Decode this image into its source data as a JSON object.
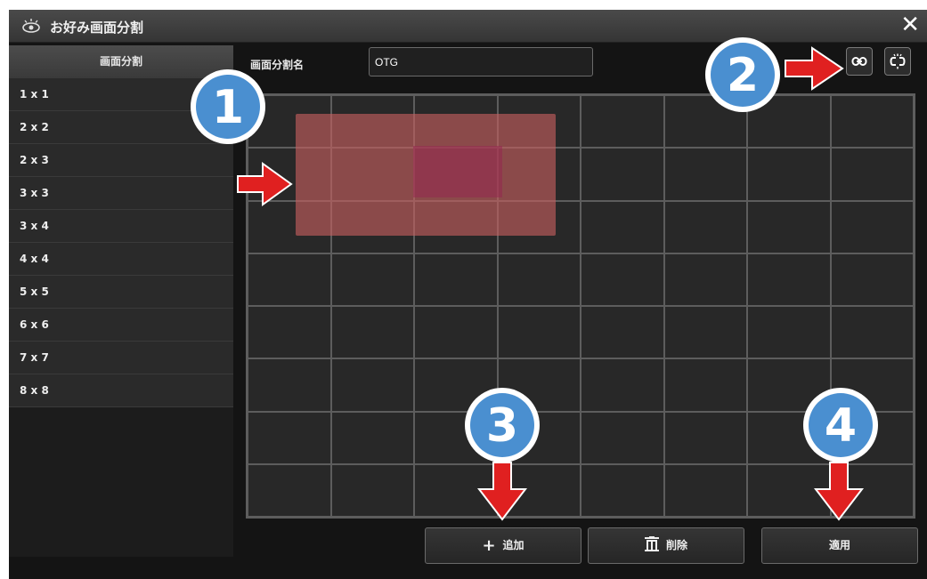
{
  "window": {
    "title": "お好み画面分割",
    "title_icon": "eye-icon",
    "close_icon": "close-icon",
    "close_glyph": "✕"
  },
  "sidebar": {
    "header": "画面分割",
    "items": [
      {
        "label": "1 x 1"
      },
      {
        "label": "2 x 2"
      },
      {
        "label": "2 x 3"
      },
      {
        "label": "3 x 3"
      },
      {
        "label": "3 x 4"
      },
      {
        "label": "4 x 4"
      },
      {
        "label": "5 x 5"
      },
      {
        "label": "6 x 6"
      },
      {
        "label": "7 x 7"
      },
      {
        "label": "8 x 8"
      }
    ]
  },
  "layout_name": {
    "label": "画面分割名",
    "value": "OTG"
  },
  "toolbar": {
    "merge_icon": "link-icon",
    "split_icon": "unlink-icon"
  },
  "grid": {
    "rows": 8,
    "cols": 8,
    "selection": {
      "row_start": 1,
      "row_end": 3,
      "col_start": 1,
      "col_end": 4
    }
  },
  "buttons": {
    "add": {
      "label": "追加",
      "icon": "plus-icon",
      "glyph": "+"
    },
    "delete": {
      "label": "削除",
      "icon": "trash-icon"
    },
    "apply": {
      "label": "適用"
    }
  },
  "callouts": [
    "1",
    "2",
    "3",
    "4"
  ],
  "colors": {
    "selection": "#c85f5f",
    "arrow": "#e02020",
    "callout_circle": "#4a8fd0",
    "callout_number": "#ffffff"
  }
}
